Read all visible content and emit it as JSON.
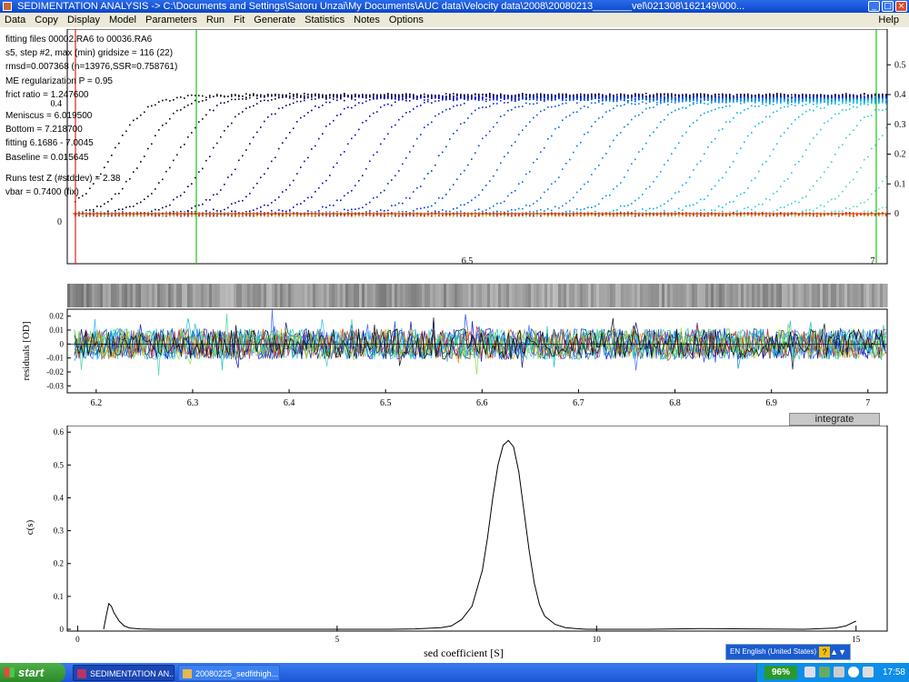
{
  "window": {
    "title": "SEDIMENTATION ANALYSIS -> C:\\Documents and Settings\\Satoru Unzai\\My Documents\\AUC data\\Velocity data\\2008\\20080213_______vel\\021308\\162149\\000...",
    "minimize_icon": "minimize-icon",
    "maximize_icon": "maximize-icon",
    "close_icon": "close-icon",
    "min_glyph": "_",
    "max_glyph": "□",
    "close_glyph": "×"
  },
  "menu": {
    "items": [
      "Data",
      "Copy",
      "Display",
      "Model",
      "Parameters",
      "Run",
      "Fit",
      "Generate",
      "Statistics",
      "Notes",
      "Options"
    ],
    "help": "Help"
  },
  "info": {
    "line1": "fitting files 00002.RA6 to 00036.RA6",
    "line2": "s5, step #2, max (min) gridsize = 116 (22)",
    "line3": "rmsd=0.007368 (n=13976,SSR=0.758761)",
    "line4": "ME regularization P = 0.95",
    "line5": "frict ratio = 1.247600",
    "line6": "Meniscus = 6.019500",
    "line7": "Bottom = 7.218700",
    "line8": "fitting 6.1686 - 7.0045",
    "line9": "Baseline = 0.015645",
    "line10": "Runs test Z (#stddev) = 2.38",
    "line11": "vbar = 0.7400 (fix)"
  },
  "chart_data": [
    {
      "type": "scatter",
      "title": "",
      "x_ticks": [
        "6.5",
        "7"
      ],
      "y_ticks": [
        "0",
        "0.4"
      ],
      "ylabel": "",
      "y2_ticks": [
        "0",
        "0.1",
        "0.2",
        "0.3",
        "0.4",
        "0.5"
      ],
      "description_series_count": 35,
      "plateau": 0.42,
      "xlim": [
        6.17,
        7.02
      ]
    },
    {
      "type": "line",
      "ylabel": "residuals [OD]",
      "y_ticks": [
        "0.02",
        "0.01",
        "0",
        "-0.01",
        "-0.02",
        "-0.03"
      ],
      "x_ticks": [
        "6.2",
        "6.3",
        "6.4",
        "6.5",
        "6.6",
        "6.7",
        "6.8",
        "6.9",
        "7"
      ],
      "ylim": [
        -0.035,
        0.025
      ],
      "xlim": [
        6.17,
        7.02
      ]
    },
    {
      "type": "line",
      "xlabel": "sed coefficient [S]",
      "ylabel": "c(s)",
      "x_ticks": [
        "0",
        "5",
        "10",
        "15"
      ],
      "y_ticks": [
        "0",
        "0.1",
        "0.2",
        "0.3",
        "0.4",
        "0.5",
        "0.6"
      ],
      "xlim": [
        -0.2,
        15.6
      ],
      "ylim": [
        0,
        0.62
      ],
      "x": [
        0.5,
        0.55,
        0.6,
        0.65,
        0.7,
        0.8,
        0.9,
        1.0,
        1.2,
        1.5,
        2,
        3,
        4,
        5,
        6,
        6.5,
        7,
        7.2,
        7.4,
        7.6,
        7.8,
        7.9,
        8.0,
        8.1,
        8.2,
        8.3,
        8.4,
        8.5,
        8.6,
        8.7,
        8.8,
        8.9,
        9.0,
        9.2,
        9.4,
        9.6,
        9.8,
        10,
        11,
        12,
        13,
        14,
        14.6,
        14.8,
        15.0
      ],
      "y": [
        0.0,
        0.04,
        0.078,
        0.07,
        0.05,
        0.025,
        0.01,
        0.004,
        0.001,
        0.0,
        0.0,
        0.0,
        0.0,
        0.0,
        0.0,
        0.001,
        0.005,
        0.01,
        0.03,
        0.07,
        0.18,
        0.28,
        0.4,
        0.5,
        0.56,
        0.575,
        0.555,
        0.48,
        0.36,
        0.24,
        0.14,
        0.075,
        0.04,
        0.015,
        0.005,
        0.002,
        0.0,
        0.0,
        0.0,
        0.002,
        0.001,
        0.0,
        0.004,
        0.01,
        0.025
      ]
    }
  ],
  "integrate_button": "integrate",
  "taskbar": {
    "start": "start",
    "tasks": [
      "SEDIMENTATION AN...",
      "20080225_sedfithigh..."
    ],
    "zoom": "96%",
    "clock": "17:58",
    "lang": "EN English (United States)",
    "lang_help": "?",
    "lang_chevron": "▲▼"
  }
}
